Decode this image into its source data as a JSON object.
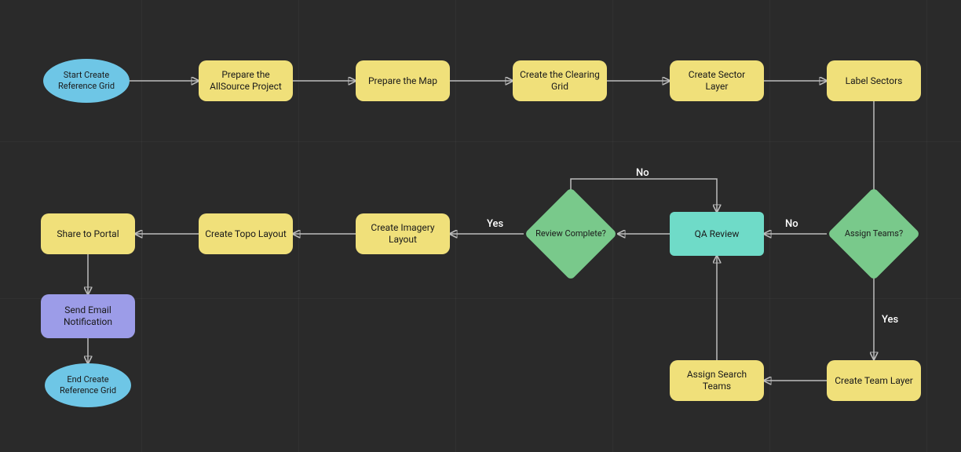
{
  "nodes": {
    "start": {
      "label": "Start Create Reference Grid"
    },
    "prepProject": {
      "label": "Prepare the AllSource Project"
    },
    "prepMap": {
      "label": "Prepare the Map"
    },
    "clearingGrid": {
      "label": "Create the Clearing Grid"
    },
    "sectorLayer": {
      "label": "Create Sector Layer"
    },
    "labelSectors": {
      "label": "Label Sectors"
    },
    "assignTeamsQ": {
      "label": "Assign Teams?"
    },
    "teamLayer": {
      "label": "Create Team Layer"
    },
    "assignSearch": {
      "label": "Assign Search Teams"
    },
    "qaReview": {
      "label": "QA Review"
    },
    "reviewQ": {
      "label": "Review Complete?"
    },
    "imgLayout": {
      "label": "Create Imagery Layout"
    },
    "topoLayout": {
      "label": "Create Topo Layout"
    },
    "sharePortal": {
      "label": "Share to Portal"
    },
    "sendEmail": {
      "label": "Send Email Notification"
    },
    "end": {
      "label": "End Create Reference Grid"
    }
  },
  "edgeLabels": {
    "assignNo": "No",
    "assignYes": "Yes",
    "reviewNo": "No",
    "reviewYes": "Yes"
  },
  "colors": {
    "background": "#2a2a2a",
    "startEnd": "#6ec6e6",
    "process": "#f0e07a",
    "subprocess": "#6fdbc8",
    "decision": "#79c98b",
    "special": "#9c9ce8",
    "edge": "#bdbdbd"
  }
}
